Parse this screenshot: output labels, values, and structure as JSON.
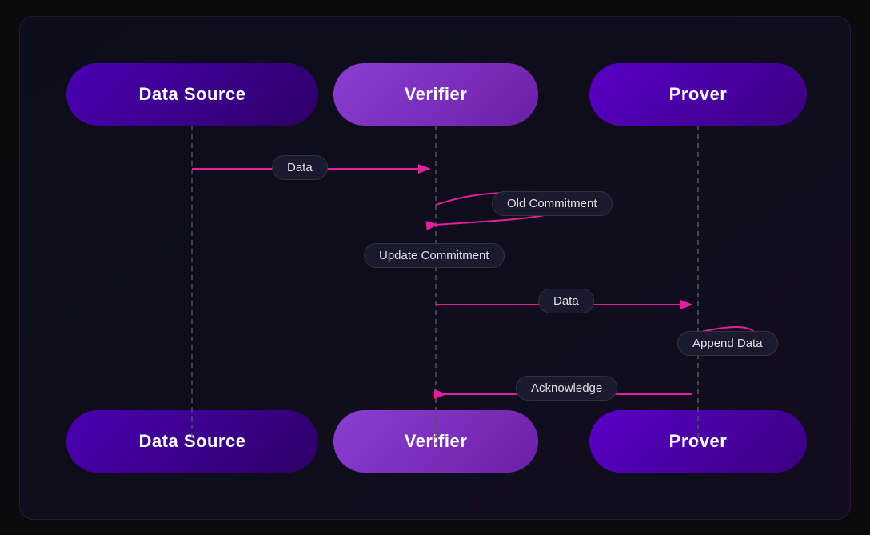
{
  "nodes": {
    "datasource_top": "Data Source",
    "verifier_top": "Verifier",
    "prover_top": "Prover",
    "datasource_bot": "Data Source",
    "verifier_bot": "Verifier",
    "prover_bot": "Prover"
  },
  "messages": {
    "data_1": "Data",
    "old_commitment": "Old Commitment",
    "update_commitment": "Update Commitment",
    "data_2": "Data",
    "append_data": "Append Data",
    "acknowledge": "Acknowledge"
  },
  "colors": {
    "arrow": "#e020a0",
    "dashed_line": "#555"
  }
}
